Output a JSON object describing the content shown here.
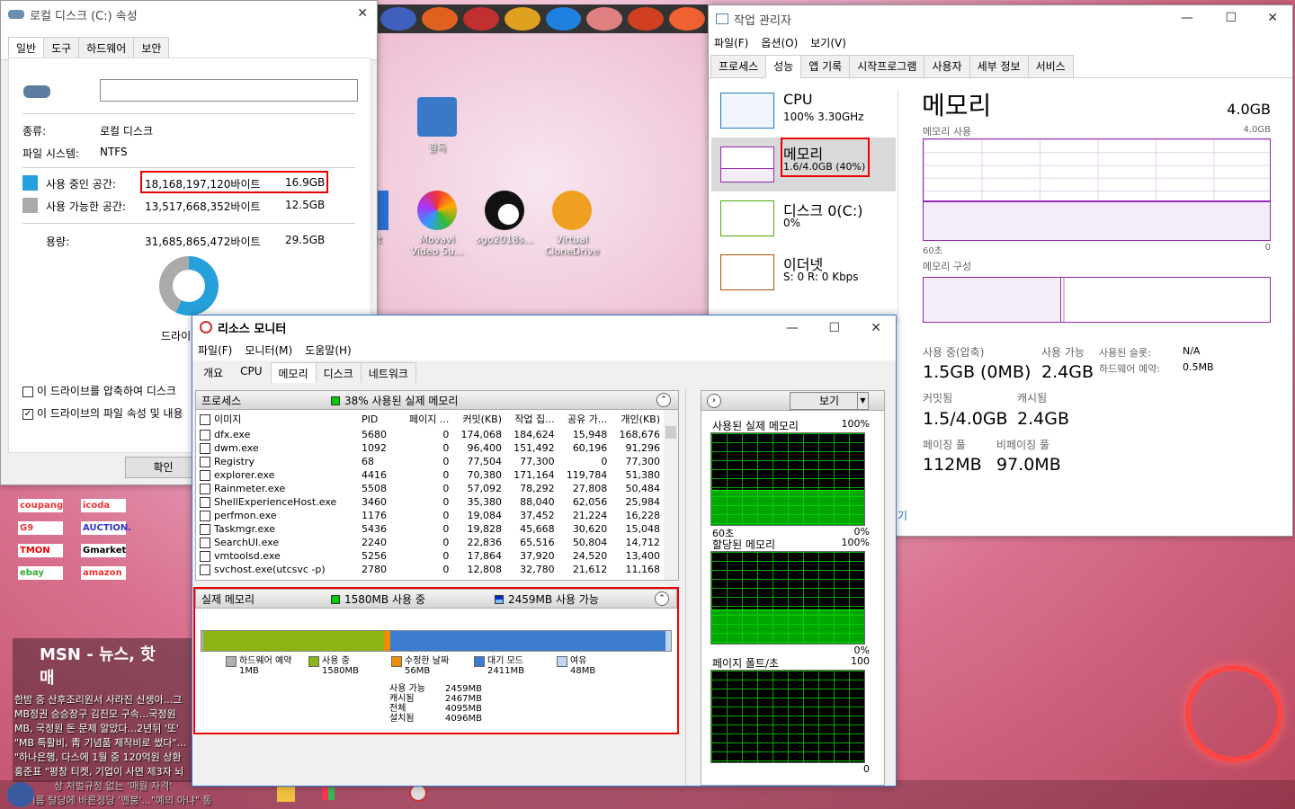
{
  "desktop": {
    "icons": [
      {
        "label": "필독"
      },
      {
        "label": "...oft"
      },
      {
        "label": "Movavi Video Su..."
      },
      {
        "label": "sgo2018s..."
      },
      {
        "label": "Virtual CloneDrive"
      }
    ],
    "shortcuts": [
      "coupang",
      "icoda",
      "G9",
      "AUCTION.",
      "TMON",
      "Gmarket",
      "ebay",
      "amazon"
    ],
    "news": {
      "title": "MSN - 뉴스, 핫매",
      "items": [
        "한밤 중 산후조리원서 사라진 신생아...그",
        "MB정권 승승장구 김진모 구속...국정원",
        "MB, 국정원 돈 문제 알았다...2년뒤 '또'",
        "\"MB 특활비, 靑 기념품 제작비로 썼다\"...",
        "\"하나은행, 다스에 1월 중 120억원 상환",
        "홍준표 \"평창 티켓, 기업이 사면 제3자 뇌",
        "상 처벌규정 없는 '매월 자격'",
        "속 기름 탈당에 바른정당 '멘붕'...\"예의 아냐\" 통"
      ]
    }
  },
  "disk_props": {
    "title": "로컬 디스크 (C:) 속성",
    "tabs": [
      "일반",
      "도구",
      "하드웨어",
      "보안"
    ],
    "name_value": "",
    "type_label": "종류:",
    "type_value": "로컬 디스크",
    "fs_label": "파일 시스템:",
    "fs_value": "NTFS",
    "used_label": "사용 중인 공간:",
    "used_bytes": "18,168,197,120바이트",
    "used_gb": "16.9GB",
    "free_label": "사용 가능한 공간:",
    "free_bytes": "13,517,668,352바이트",
    "free_gb": "12.5GB",
    "cap_label": "용량:",
    "cap_bytes": "31,685,865,472바이트",
    "cap_gb": "29.5GB",
    "drive_label": "드라이",
    "compress": "이 드라이브를 압축하여 디스크",
    "index": "이 드라이브의 파일 속성 및 내용",
    "ok": "확인",
    "used_color": "#26a0da",
    "free_color": "#aaaaaa",
    "used_fraction": 0.573
  },
  "taskmgr": {
    "title": "작업 관리자",
    "menu": [
      "파일(F)",
      "옵션(O)",
      "보기(V)"
    ],
    "tabs": [
      "프로세스",
      "성능",
      "앱 기록",
      "시작프로그램",
      "사용자",
      "세부 정보",
      "서비스"
    ],
    "side": [
      {
        "name": "CPU",
        "value": "100% 3.30GHz"
      },
      {
        "name": "메모리",
        "value": "1.6/4.0GB (40%)"
      },
      {
        "name": "디스크 0(C:)",
        "value": "0%"
      },
      {
        "name": "이더넷",
        "value": "S: 0 R: 0 Kbps"
      }
    ],
    "heading": "메모리",
    "total": "4.0GB",
    "usage_label": "메모리 사용",
    "usage_max": "4.0GB",
    "time_label": "60초",
    "zero": "0",
    "composition_label": "메모리 구성",
    "stats": {
      "inuse_label": "사용 중(압축)",
      "inuse": "1.5GB (0MB)",
      "avail_label": "사용 가능",
      "avail": "2.4GB",
      "slots_label": "사용된 슬롯:",
      "slots": "N/A",
      "hwres_label": "하드웨어 예약:",
      "hwres": "0.5MB",
      "committed_label": "커밋됨",
      "committed": "1.5/4.0GB",
      "cached_label": "캐시됨",
      "cached": "2.4GB",
      "paged_label": "페이징 풀",
      "paged": "112MB",
      "nonpaged_label": "비페이징 풀",
      "nonpaged": "97.0MB"
    },
    "open_link": "기",
    "accent": "#9528b4"
  },
  "resmon": {
    "title": "리소스 모니터",
    "menu": [
      "파일(F)",
      "모니터(M)",
      "도움말(H)"
    ],
    "tabs": [
      "개요",
      "CPU",
      "메모리",
      "디스크",
      "네트워크"
    ],
    "proc_header": "프로세스",
    "proc_status": "38% 사용된 실제 메모리",
    "columns": [
      "이미지",
      "PID",
      "페이지 ...",
      "커밋(KB)",
      "작업 집...",
      "공유 가...",
      "개인(KB)"
    ],
    "rows": [
      [
        "dfx.exe",
        "5680",
        "0",
        "174,068",
        "184,624",
        "15,948",
        "168,676"
      ],
      [
        "dwm.exe",
        "1092",
        "0",
        "96,400",
        "151,492",
        "60,196",
        "91,296"
      ],
      [
        "Registry",
        "68",
        "0",
        "77,504",
        "77,300",
        "0",
        "77,300"
      ],
      [
        "explorer.exe",
        "4416",
        "0",
        "70,380",
        "171,164",
        "119,784",
        "51,380"
      ],
      [
        "Rainmeter.exe",
        "5508",
        "0",
        "57,092",
        "78,292",
        "27,808",
        "50,484"
      ],
      [
        "ShellExperienceHost.exe",
        "3460",
        "0",
        "35,380",
        "88,040",
        "62,056",
        "25,984"
      ],
      [
        "perfmon.exe",
        "1176",
        "0",
        "19,084",
        "37,452",
        "21,224",
        "16,228"
      ],
      [
        "Taskmgr.exe",
        "5436",
        "0",
        "19,828",
        "45,668",
        "30,620",
        "15,048"
      ],
      [
        "SearchUI.exe",
        "2240",
        "0",
        "22,836",
        "65,516",
        "50,804",
        "14,712"
      ],
      [
        "vmtoolsd.exe",
        "5256",
        "0",
        "17,864",
        "37,920",
        "24,520",
        "13,400"
      ],
      [
        "svchost.exe(utcsvc -p)",
        "2780",
        "0",
        "12,808",
        "32,780",
        "21,612",
        "11,168"
      ]
    ],
    "phys_header": "실제 메모리",
    "phys_inuse": "1580MB 사용 중",
    "phys_avail": "2459MB 사용 가능",
    "bar": [
      {
        "label": "하드웨어 예약",
        "value": "1MB",
        "mb": 1,
        "color": "#b0b0b0"
      },
      {
        "label": "사용 중",
        "value": "1580MB",
        "mb": 1580,
        "color": "#8ab513"
      },
      {
        "label": "수정한 날짜",
        "value": "56MB",
        "mb": 56,
        "color": "#f08c00"
      },
      {
        "label": "대기 모드",
        "value": "2411MB",
        "mb": 2411,
        "color": "#3c7ccf"
      },
      {
        "label": "여유",
        "value": "48MB",
        "mb": 48,
        "color": "#c0d6f0"
      }
    ],
    "summary": [
      {
        "label": "사용 가능",
        "value": "2459MB"
      },
      {
        "label": "캐시됨",
        "value": "2467MB"
      },
      {
        "label": "전체",
        "value": "4095MB"
      },
      {
        "label": "설치됨",
        "value": "4096MB"
      }
    ],
    "view_button": "보기",
    "graphs": [
      {
        "title": "사용된 실제 메모리",
        "max": "100%",
        "left": "60초",
        "min": "0%"
      },
      {
        "title": "할당된 메모리",
        "max": "100%",
        "left": "",
        "min": "0%"
      },
      {
        "title": "페이지 폴트/초",
        "max": "100",
        "left": "",
        "min": "0"
      }
    ]
  }
}
